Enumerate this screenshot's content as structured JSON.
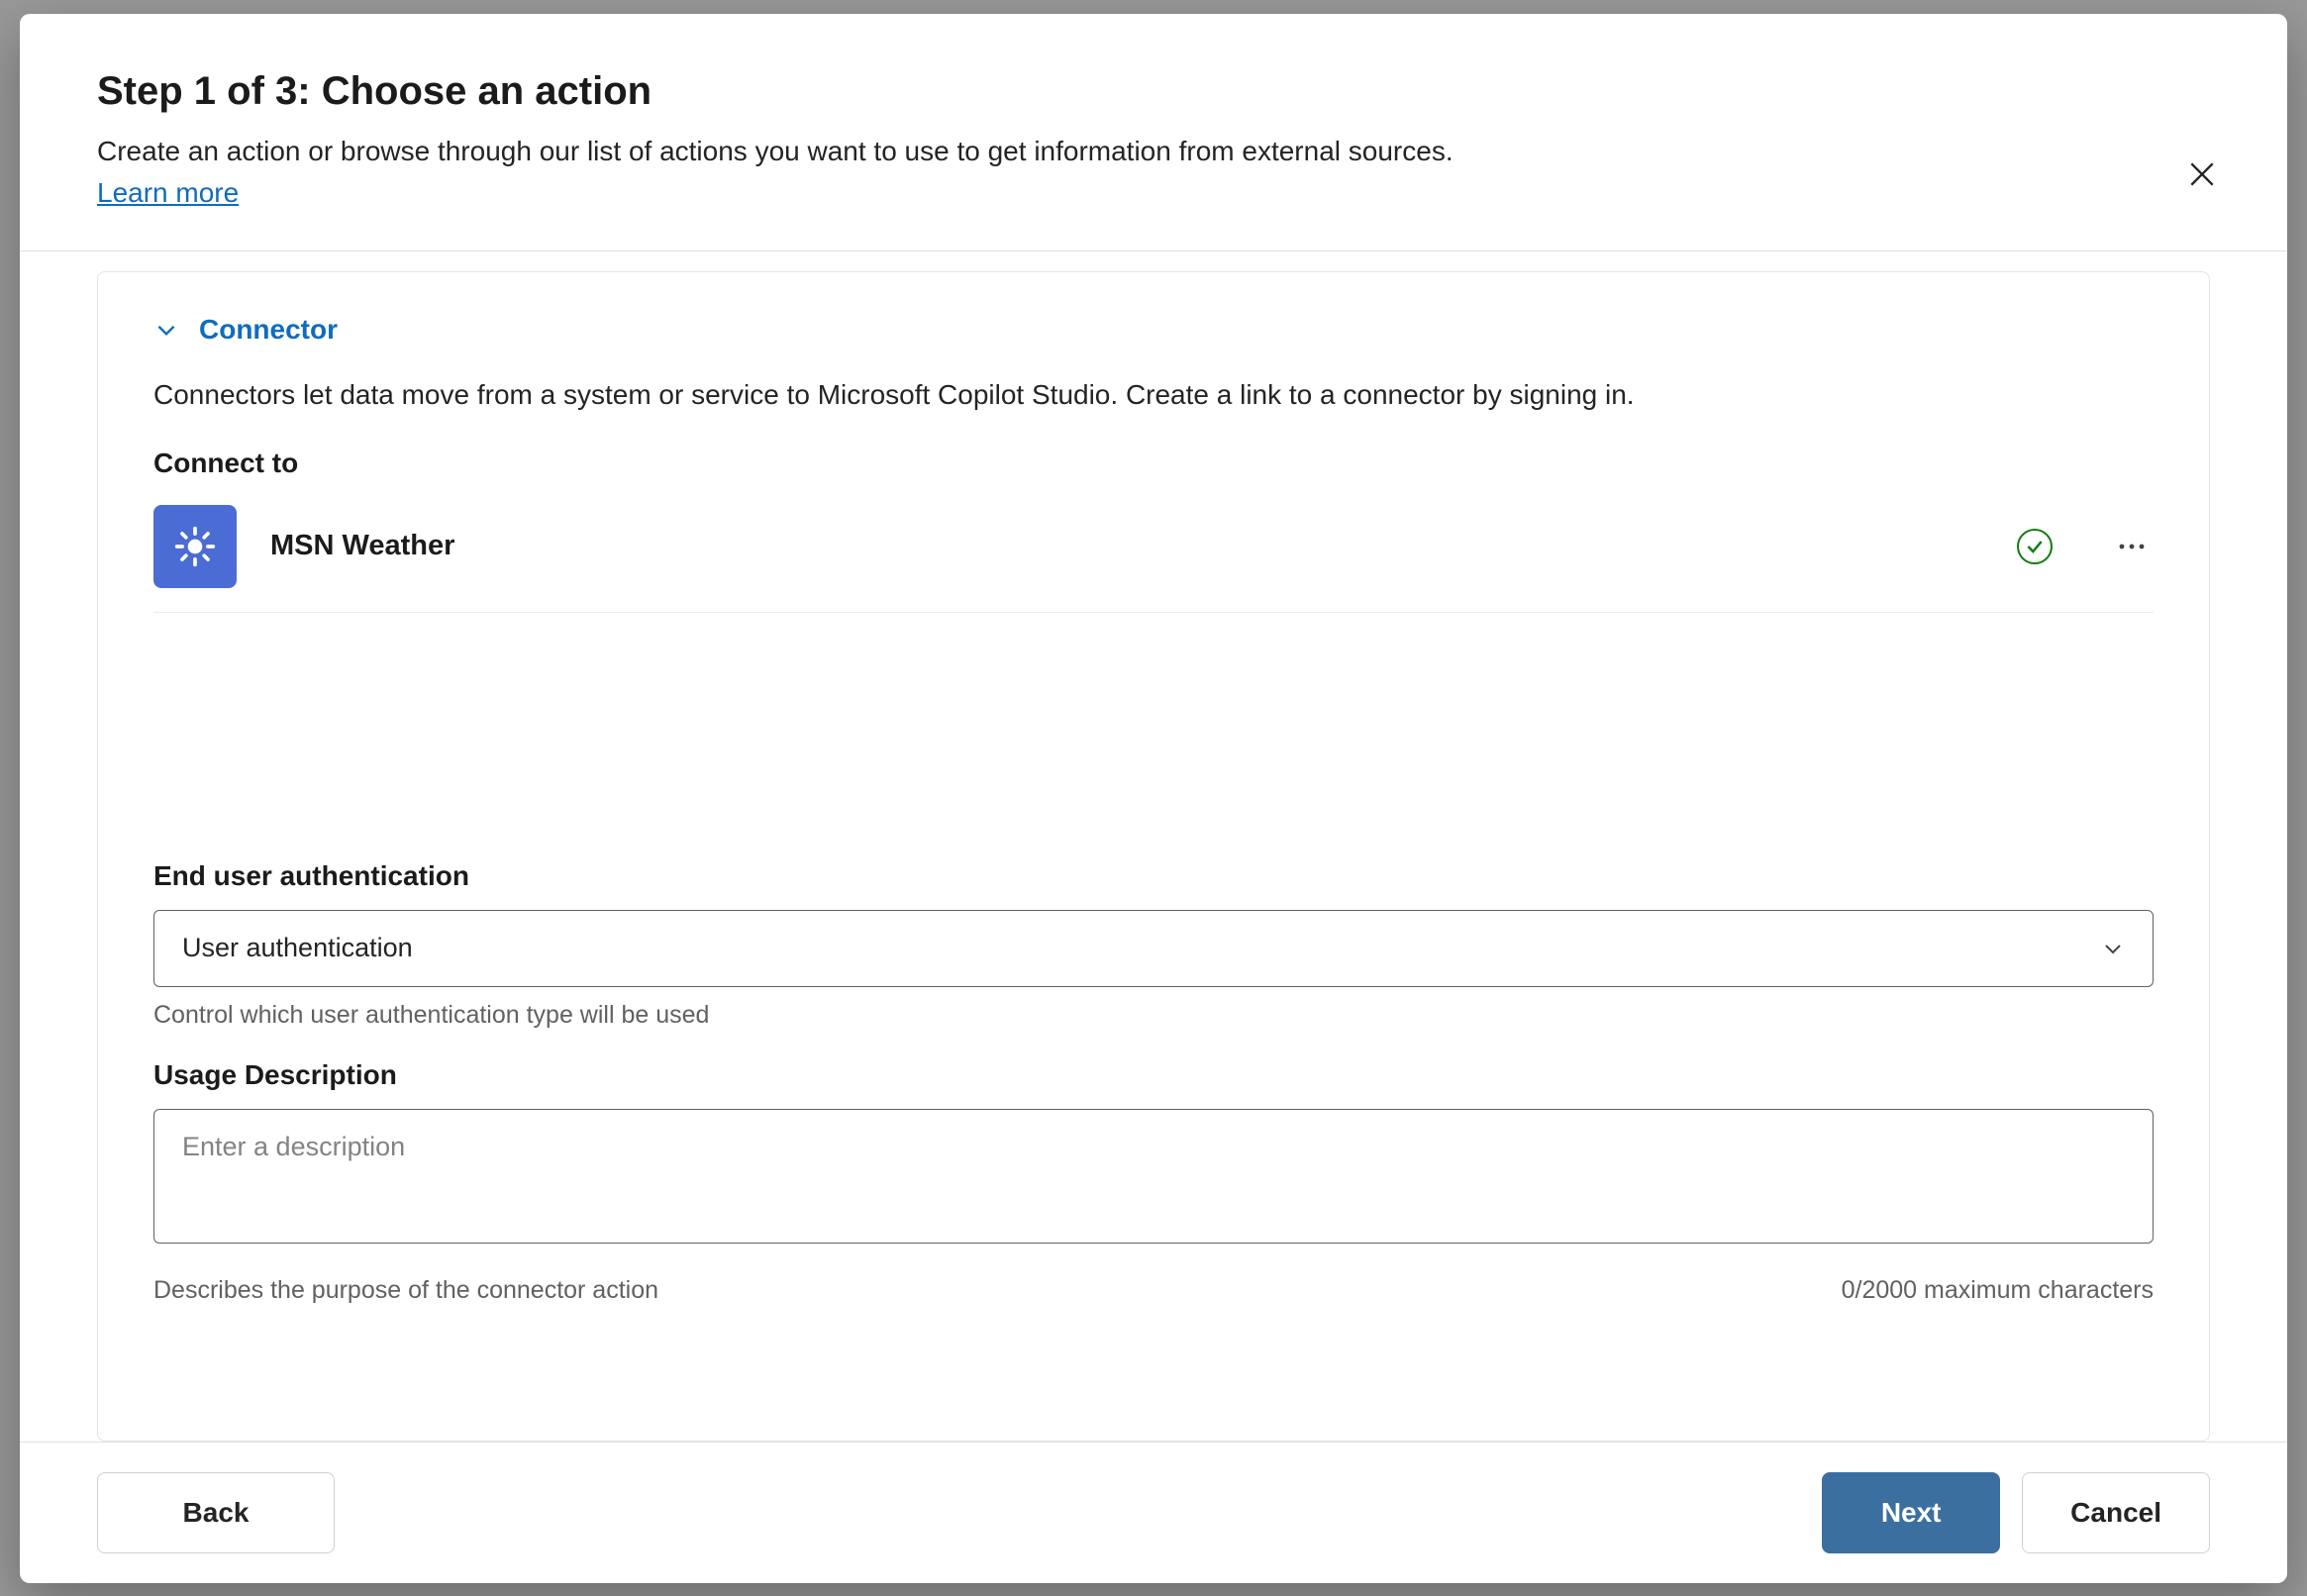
{
  "header": {
    "title": "Step 1 of 3: Choose an action",
    "subtitle": "Create an action or browse through our list of actions you want to use to get information from external sources.",
    "learn_more": "Learn more"
  },
  "connector_section": {
    "heading": "Connector",
    "description": "Connectors let data move from a system or service to Microsoft Copilot Studio. Create a link to a connector by signing in.",
    "connect_to_label": "Connect to",
    "item": {
      "name": "MSN Weather",
      "icon": "sun-icon",
      "status": "connected"
    }
  },
  "auth": {
    "label": "End user authentication",
    "value": "User authentication",
    "helper": "Control which user authentication type will be used"
  },
  "usage": {
    "label": "Usage Description",
    "placeholder": "Enter a description",
    "helper": "Describes the purpose of the connector action",
    "counter": "0/2000 maximum characters"
  },
  "footer": {
    "back": "Back",
    "next": "Next",
    "cancel": "Cancel"
  }
}
